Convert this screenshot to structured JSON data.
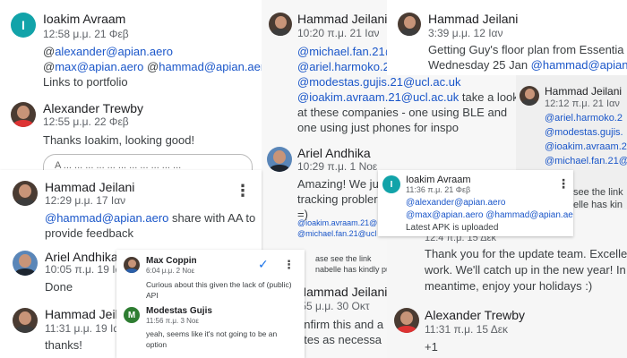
{
  "cards": {
    "c1": {
      "m1": {
        "name": "Ioakim Avraam",
        "avatar": "I",
        "time": "12:58 μ.μ. 21 Φεβ",
        "at1": "@",
        "m_alex": "alexander@apian.aero",
        "at2": "@",
        "m_max": "max@apian.aero",
        "sp": " ",
        "at3": "@",
        "m_hammad": "hammad@apian.aero",
        "text": "Links to portfolio"
      },
      "m2": {
        "name": "Alexander Trewby",
        "time": "12:55 μ.μ. 22 Φεβ",
        "text": "Thanks  Ioakim, looking good!"
      },
      "input_fragment": "A ... ... ... ... ... ... ... ... ... ... ..."
    },
    "c2": {
      "m1": {
        "name": "Hammad Jeilani",
        "time": "10:20 π.μ. 21 Ιαν",
        "l1": "@michael.fan.21@",
        "l2": "@ariel.harmoko.21",
        "l3": "@modestas.gujis.21@ucl.ac.uk",
        "l4_link": "@ioakim.avraam.21@ucl.ac.uk",
        "l4_text": " take a look",
        "l5": "at these companies - one using BLE and",
        "l6": "one using just phones for inspo"
      },
      "m2": {
        "name": "Ariel Andhika",
        "time": "10:29 π.μ. 1 Νοε",
        "l1": "Amazing! We ju",
        "l2": "tracking probler",
        "l3": "=)"
      },
      "fragment1": "@ioakim.avraam.21@",
      "fragment2": "@michael.fan.21@ucl",
      "fragment3": "ase see the link",
      "fragment4": "nabelle has kindly put t",
      "m3": {
        "name": "Hammad Jeilani",
        "time": ":55 μ.μ. 30 Οκτ",
        "l1": "onfirm this and a",
        "l2": "ates as necessa"
      }
    },
    "c3": {
      "name": "Hammad Jeilani",
      "time": "3:39 μ.μ. 12 Ιαν",
      "l1": "Getting Guy's floor plan from Essentia on",
      "l2_text": "Wednesday 25 Jan ",
      "l2_link": "@hammad@apian"
    },
    "c4": {
      "name": "Hammad Jeilani",
      "time": "12:12 π.μ. 21 Ιαν",
      "l1": "@ariel.harmoko.2",
      "l2": "@modestas.gujis.",
      "l3": "@ioakim.avraam.2",
      "l4": "@michael.fan.21@",
      "l5": "see the link",
      "l6": "elle has kin"
    },
    "c5": {
      "m1": {
        "name": "Hammad Jeilani",
        "time": "12:29 μ.μ. 17 Ιαν",
        "l1_link": "@hammad@apian.aero",
        "l1_text": " share with AA to",
        "l2": "provide feedback"
      },
      "m2": {
        "name": "Ariel Andhika",
        "time": "10:05 π.μ. 19 Ιαν",
        "text": "Done"
      },
      "m3": {
        "name": "Hammad Jeilani",
        "time": "11:31 μ.μ. 19 Ιαν",
        "text": "thanks!"
      }
    },
    "c6": {
      "m1": {
        "name": "Max Coppin",
        "time": "6:04 μ.μ. 2 Νοε",
        "l1": "Curious about this given the lack of (public)",
        "l2": "API"
      },
      "m2": {
        "name": "Modestas Gujis",
        "avatar": "M",
        "time": "11:56 π.μ. 3 Νοε",
        "l1": "yeah, seems like it's not going to be an",
        "l2": "option"
      }
    },
    "c7": {
      "name": "Ioakim Avraam",
      "avatar": "I",
      "time": "11:36 π.μ. 21 Φεβ",
      "l1": "@alexander@apian.aero",
      "l2": "@max@apian.aero @hammad@apian.aero",
      "l3": "Latest APK is uploaded"
    },
    "c8": {
      "time_partial": "12:4 π.μ. 15 Δεκ",
      "l1": "Thank you for the update team. Excellent",
      "l2": "work. We'll catch up in the new year! In the",
      "l3": "meantime, enjoy your holidays :)",
      "m2": {
        "name": "Alexander Trewby",
        "time": "11:31 π.μ. 15 Δεκ",
        "text": "+1"
      }
    }
  },
  "icons": {
    "kebab": "⋮",
    "check": "✓"
  },
  "colors": {
    "link": "#1a56c9",
    "teal_avatar": "#12a3a9",
    "green_avatar": "#2e7d32",
    "check": "#1a73e8"
  }
}
